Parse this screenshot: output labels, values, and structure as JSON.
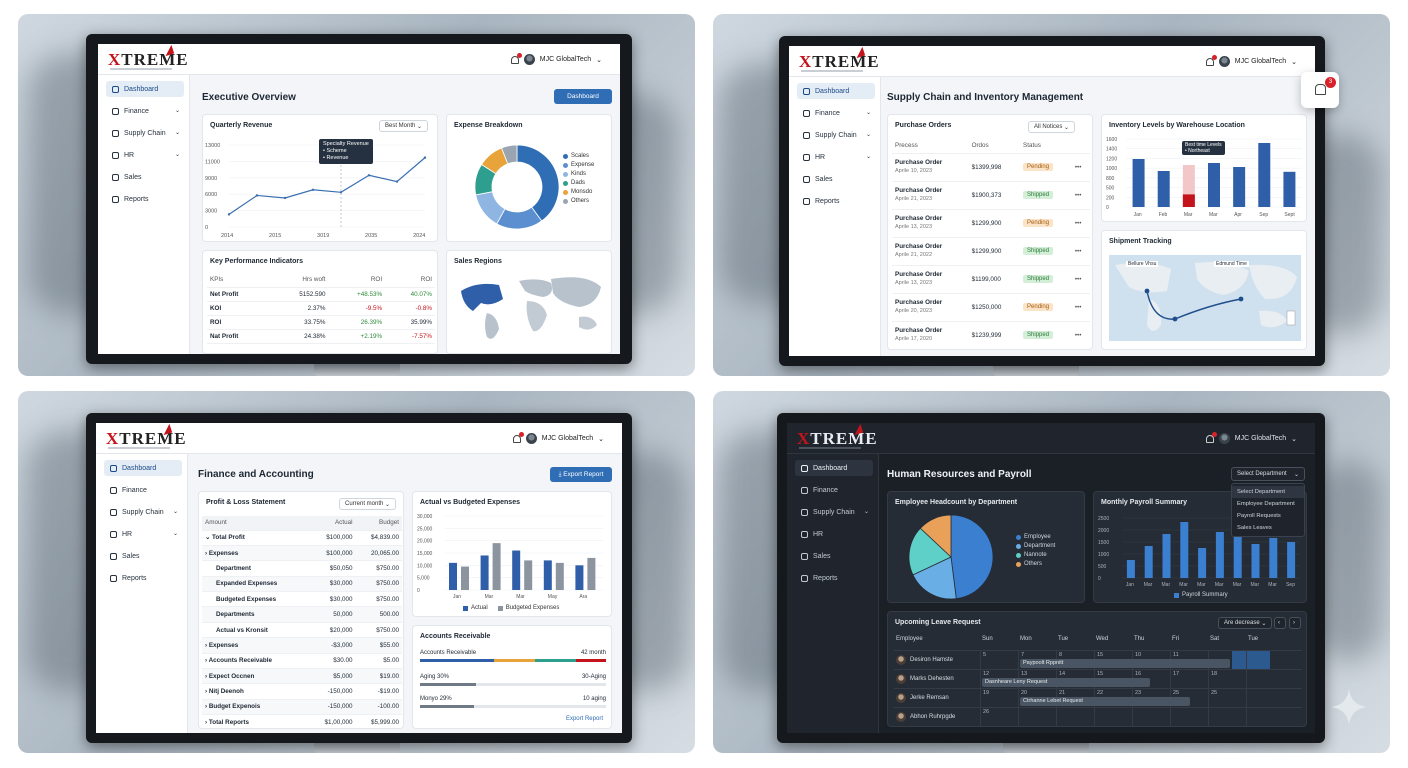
{
  "brand": {
    "logo_x": "X",
    "logo_rest": "TREME"
  },
  "panels": {
    "executive": {
      "user": "MJC GlobalTech",
      "nav": [
        {
          "label": "Dashboard",
          "chev": ""
        },
        {
          "label": "Finance",
          "chev": "⌄"
        },
        {
          "label": "Supply Chain",
          "chev": "⌄"
        },
        {
          "label": "HR",
          "chev": "⌄"
        },
        {
          "label": "Sales",
          "chev": ""
        },
        {
          "label": "Reports",
          "chev": ""
        }
      ],
      "title": "Executive Overview",
      "button": "Dashboard",
      "revenue": {
        "title": "Quarterly Revenue",
        "select": "Best Month",
        "tooltip_title": "Specialty Revenue",
        "tooltip_lines": [
          "• Scheme",
          "• Revenue"
        ]
      },
      "expense": {
        "title": "Expense Breakdown",
        "legend": [
          "Scales",
          "Expense",
          "Kinds",
          "Dads",
          "Monsdo",
          "Others"
        ]
      },
      "kpi": {
        "title": "Key Performance Indicators",
        "headers": [
          "KPIs",
          "Hrs woft",
          "ROI",
          "ROI"
        ],
        "rows": [
          [
            "Net Profit",
            "5152.590",
            "+48.53%",
            "40.07%"
          ],
          [
            "KOI",
            "2.37%",
            "-9.5%",
            "-0.8%"
          ],
          [
            "ROI",
            "33.75%",
            "26.39%",
            "35.99%"
          ],
          [
            "Nat Profit",
            "24.38%",
            "+2.19%",
            "-7.57%"
          ]
        ]
      },
      "regions": {
        "title": "Sales Regions"
      }
    },
    "supply": {
      "user": "MJC GlobalTech",
      "nav": [
        {
          "label": "Dashboard",
          "chev": ""
        },
        {
          "label": "Finance",
          "chev": "⌄"
        },
        {
          "label": "Supply Chain",
          "chev": "⌄"
        },
        {
          "label": "HR",
          "chev": "⌄"
        },
        {
          "label": "Sales",
          "chev": ""
        },
        {
          "label": "Reports",
          "chev": ""
        }
      ],
      "title": "Supply Chain and Inventory Management",
      "notif_count": "3",
      "orders": {
        "title": "Purchase Orders",
        "select": "All Notices",
        "headers": [
          "Precess",
          "Ordos",
          "Status"
        ],
        "rows": [
          {
            "name": "Purchase Order",
            "date": "Aprile 10, 2023",
            "amount": "$1399,998",
            "status": "Pending",
            "kind": "pending"
          },
          {
            "name": "Purchase Order",
            "date": "Aprile 21, 2023",
            "amount": "$1900,373",
            "status": "Shipped",
            "kind": "shipped"
          },
          {
            "name": "Purchase Order",
            "date": "Aprile 13, 2023",
            "amount": "$1299,900",
            "status": "Pending",
            "kind": "pending"
          },
          {
            "name": "Purchase Order",
            "date": "Aprile 21, 2022",
            "amount": "$1299,900",
            "status": "Shipped",
            "kind": "shipped"
          },
          {
            "name": "Purchase Order",
            "date": "Aprile 13, 2023",
            "amount": "$1199,000",
            "status": "Shipped",
            "kind": "shipped"
          },
          {
            "name": "Purchase Order",
            "date": "Aprile 20, 2023",
            "amount": "$1250,000",
            "status": "Pending",
            "kind": "pending"
          },
          {
            "name": "Purchase Order",
            "date": "Aprile 17, 2020",
            "amount": "$1239,999",
            "status": "Shipped",
            "kind": "shipped"
          }
        ]
      },
      "inventory": {
        "title": "Inventory Levels by Warehouse Location",
        "tooltip_lines": [
          "Best time Levels",
          "• Northeast"
        ]
      },
      "tracking": {
        "title": "Shipment Tracking",
        "label_a": "Bellure Vhsu",
        "label_b": "Edmund Time"
      }
    },
    "finance": {
      "user": "MJC GlobalTech",
      "nav": [
        {
          "label": "Dashboard",
          "chev": ""
        },
        {
          "label": "Finance",
          "chev": ""
        },
        {
          "label": "Supply Chain",
          "chev": "⌄"
        },
        {
          "label": "HR",
          "chev": "⌄"
        },
        {
          "label": "Sales",
          "chev": ""
        },
        {
          "label": "Reports",
          "chev": ""
        }
      ],
      "title": "Finance and Accounting",
      "button": "Export Report",
      "pl": {
        "title": "Profit & Loss Statement",
        "select": "Current month",
        "headers": [
          "Amount",
          "Actual",
          "Budget"
        ],
        "rows": [
          [
            "⌄ Total Profit",
            "$100,000",
            "$4,839.00"
          ],
          [
            "› Expenses",
            "$100,000",
            "20,065.00"
          ],
          [
            "Department",
            "$50,050",
            "$750.00"
          ],
          [
            "Expanded Expenses",
            "$30,000",
            "$750.00"
          ],
          [
            "Budgeted Expenses",
            "$30,000",
            "$750.00"
          ],
          [
            "Departments",
            "50,000",
            "500.00"
          ],
          [
            "Actual vs Kronsit",
            "$20,000",
            "$750.00"
          ],
          [
            "› Expenses",
            "-$3,000",
            "$55.00"
          ],
          [
            "› Accounts Receivable",
            "$30.00",
            "$5.00"
          ],
          [
            "› Expect Occnen",
            "$5,000",
            "$19.00"
          ],
          [
            "› Nitj Deenoh",
            "-150,000",
            "-$19.00"
          ],
          [
            "› Budget Expenois",
            "-150,000",
            "-100.00"
          ],
          [
            "› Total Reports",
            "$1,00,000",
            "$5,999.00"
          ]
        ]
      },
      "avb": {
        "title": "Actual vs Budgeted Expenses",
        "legend": [
          "Actual",
          "Budgeted Expenses"
        ]
      },
      "ar": {
        "title": "Accounts Receivable",
        "rows": [
          {
            "left": "Accounts Receivable",
            "right": "42 month"
          },
          {
            "left": "Aging 30%",
            "right": "30-Aging"
          },
          {
            "left": "Monyo 29%",
            "right": "10 aging"
          }
        ],
        "link": "Export Report"
      }
    },
    "hr": {
      "user": "MJC GlobalTech",
      "nav": [
        {
          "label": "Dashboard",
          "chev": ""
        },
        {
          "label": "Finance",
          "chev": ""
        },
        {
          "label": "Supply Chain",
          "chev": "⌄"
        },
        {
          "label": "HR",
          "chev": ""
        },
        {
          "label": "Sales",
          "chev": ""
        },
        {
          "label": "Reports",
          "chev": ""
        }
      ],
      "title": "Human Resources and Payroll",
      "dropdown": {
        "selected": "Select Department",
        "options": [
          "Select Department",
          "Employee Department",
          "Payroll Requests",
          "Sales Leaves"
        ]
      },
      "headcount": {
        "title": "Employee Headcount by Department",
        "legend": [
          "Employee",
          "Department",
          "Nannote",
          "Others"
        ]
      },
      "payroll": {
        "title": "Monthly Payroll Summary",
        "legend": "Payroll Summary"
      },
      "leave": {
        "title": "Upcoming Leave Request",
        "select": "Are decrease",
        "headers": [
          "Employee",
          "Sun",
          "Mon",
          "Tue",
          "Wed",
          "Thu",
          "Fri",
          "Sat",
          "Tue"
        ],
        "rows": [
          {
            "name": "Desiron Hamste",
            "bar": "Paypoolt Rppnitt"
          },
          {
            "name": "Marks Dehesten",
            "bar": "Dasnheare Leny Request"
          },
          {
            "name": "Jerke Remsan",
            "bar": "Ctrhanne Lebet Request"
          },
          {
            "name": "Abhon Ruhrpgde",
            "bar": ""
          }
        ]
      }
    }
  },
  "chart_data": [
    {
      "type": "line",
      "title": "Quarterly Revenue",
      "x": [
        "2014",
        "2015",
        "3019",
        "2035",
        "2024"
      ],
      "yticks": [
        "13000",
        "11000",
        "9000",
        "6000",
        "3000",
        "0"
      ],
      "values": [
        2000,
        5000,
        4600,
        5900,
        5500,
        8200,
        7200,
        11000
      ],
      "ylim": [
        0,
        13000
      ]
    },
    {
      "type": "pie",
      "title": "Expense Breakdown",
      "labels": [
        "Scales",
        "Expense",
        "Kinds",
        "Dads",
        "Monsdo",
        "Others"
      ],
      "values": [
        40,
        18,
        14,
        12,
        10,
        6
      ],
      "colors": [
        "#2f6db5",
        "#5b8fd0",
        "#8fb5e3",
        "#2e9e8e",
        "#e8a33a",
        "#9aa5b1"
      ]
    },
    {
      "type": "bar",
      "title": "Inventory Levels by Warehouse Location",
      "categories": [
        "Jan",
        "Feb",
        "Mar",
        "Mar",
        "Apr",
        "Sep",
        "Sept"
      ],
      "values": [
        1200,
        900,
        1050,
        1100,
        1000,
        1600,
        880
      ],
      "highlight_index": 2,
      "yticks": [
        "1600",
        "1400",
        "1200",
        "1000",
        "800",
        "500",
        "200",
        "0"
      ],
      "ylim": [
        0,
        1700
      ]
    },
    {
      "type": "bar",
      "title": "Actual vs Budgeted Expenses",
      "categories": [
        "Jan",
        "Mar",
        "Mar",
        "May",
        "Ara"
      ],
      "series": [
        {
          "name": "Actual",
          "values": [
            11000,
            14000,
            16000,
            12000,
            10000
          ]
        },
        {
          "name": "Budgeted Expenses",
          "values": [
            9500,
            19000,
            12000,
            11000,
            13000
          ]
        }
      ],
      "yticks": [
        "30,000",
        "25,000",
        "20,000",
        "15,000",
        "10,000",
        "5,000",
        "0"
      ],
      "ylim": [
        0,
        30000
      ]
    },
    {
      "type": "pie",
      "title": "Employee Headcount by Department",
      "labels": [
        "Employee",
        "Department",
        "Nannote",
        "Others"
      ],
      "values": [
        48,
        20,
        19,
        13
      ],
      "colors": [
        "#3a7fd0",
        "#6aaee6",
        "#5fd0c8",
        "#e9a15a"
      ]
    },
    {
      "type": "bar",
      "title": "Monthly Payroll Summary",
      "categories": [
        "Jan",
        "Mar",
        "Mar",
        "Mar",
        "Mar",
        "Mar",
        "Mar",
        "Mar",
        "Mar",
        "Sep"
      ],
      "values": [
        900,
        1600,
        2200,
        2800,
        1500,
        2300,
        2600,
        1700,
        2000,
        1800
      ],
      "yticks": [
        "2500",
        "2000",
        "1500",
        "1000",
        "500",
        "0"
      ],
      "ylim": [
        0,
        3000
      ]
    }
  ]
}
